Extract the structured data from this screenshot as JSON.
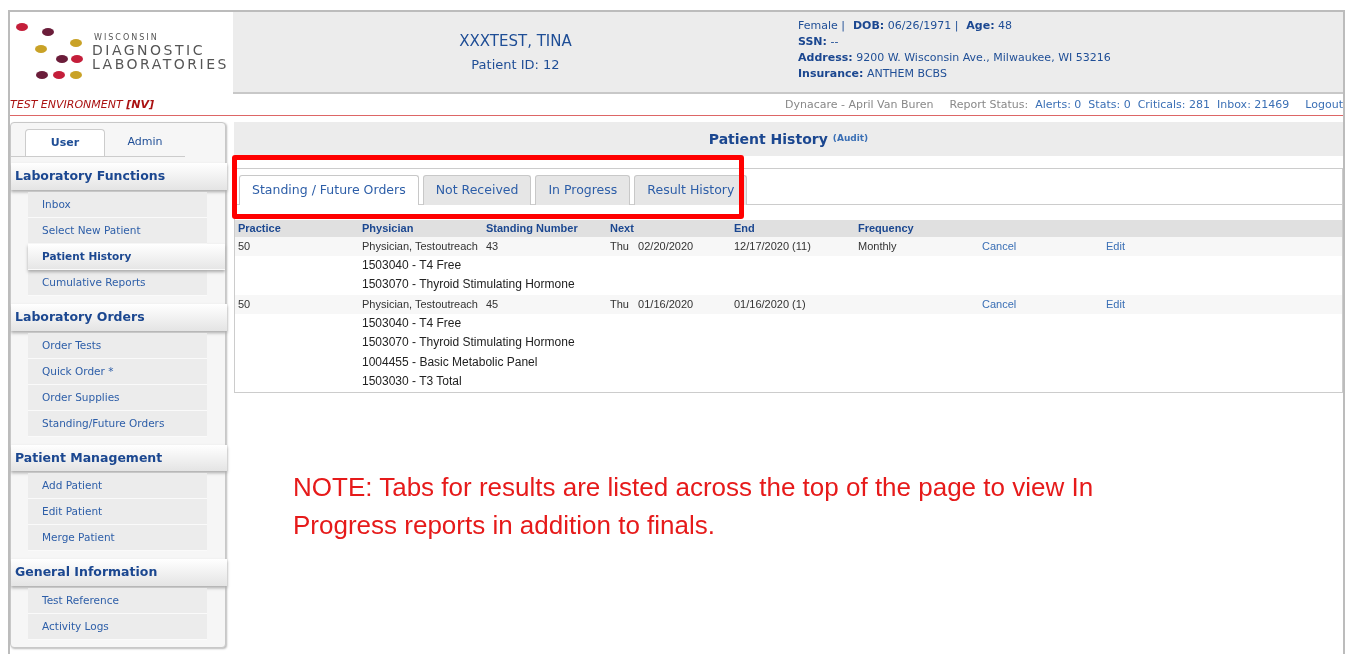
{
  "logo": {
    "lines": [
      "WISCONSIN",
      "DIAGNOSTIC",
      "LABORATORIES"
    ]
  },
  "environment": {
    "label": "TEST ENVIRONMENT",
    "code": "[NV]"
  },
  "patient": {
    "name": "XXXTEST,  TINA",
    "id_label": "Patient ID:",
    "id": "12"
  },
  "demographics": [
    [
      {
        "value": "Female",
        "separator": "|"
      },
      {
        "label": "DOB:",
        "value": "06/26/1971",
        "separator": "|"
      },
      {
        "label": "Age:",
        "value": "48"
      }
    ],
    [
      {
        "label": "SSN:",
        "value": "--"
      }
    ],
    [
      {
        "label": "Address:",
        "value": "9200 W. Wisconsin Ave., Milwaukee, WI 53216"
      }
    ],
    [
      {
        "label": "Insurance:",
        "value": "ANTHEM BCBS"
      }
    ]
  ],
  "status_bar": {
    "user": "Dynacare - April Van Buren",
    "report_label": "Report Status:",
    "links": [
      "Alerts: 0",
      "Stats: 0",
      "Criticals: 281",
      "Inbox: 21469",
      "Logout"
    ]
  },
  "sidebar": {
    "tabs": [
      {
        "label": "User",
        "selected": true
      },
      {
        "label": "Admin",
        "selected": false
      }
    ],
    "sections": [
      {
        "title": "Laboratory Functions",
        "items": [
          {
            "label": "Inbox",
            "selected": false
          },
          {
            "label": "Select New Patient",
            "selected": false
          },
          {
            "label": "Patient History",
            "selected": true
          },
          {
            "label": "Cumulative Reports",
            "selected": false
          }
        ]
      },
      {
        "title": "Laboratory Orders",
        "items": [
          {
            "label": "Order Tests",
            "selected": false
          },
          {
            "label": "Quick Order *",
            "selected": false
          },
          {
            "label": "Order Supplies",
            "selected": false
          },
          {
            "label": "Standing/Future Orders",
            "selected": false
          }
        ]
      },
      {
        "title": "Patient Management",
        "items": [
          {
            "label": "Add Patient",
            "selected": false
          },
          {
            "label": "Edit Patient",
            "selected": false
          },
          {
            "label": "Merge Patient",
            "selected": false
          }
        ]
      },
      {
        "title": "General Information",
        "items": [
          {
            "label": "Test Reference",
            "selected": false
          },
          {
            "label": "Activity Logs",
            "selected": false
          }
        ]
      }
    ]
  },
  "page": {
    "title": "Patient History",
    "subtitle": "(Audit)"
  },
  "tabs": [
    {
      "label": "Standing / Future Orders",
      "selected": true
    },
    {
      "label": "Not Received",
      "selected": false
    },
    {
      "label": "In Progress",
      "selected": false
    },
    {
      "label": "Result History",
      "selected": false
    }
  ],
  "table": {
    "columns": [
      "Practice",
      "Physician",
      "Standing Number",
      "Next",
      "End",
      "Frequency"
    ],
    "rows": [
      {
        "practice": "50",
        "physician": "Physician, Testoutreach",
        "standing_number": "43",
        "next_day": "Thu",
        "next_date": "02/20/2020",
        "end": "12/17/2020 (11)",
        "frequency": "Monthly",
        "cancel": "Cancel",
        "edit": "Edit",
        "tests": [
          "1503040 - T4 Free",
          "1503070 - Thyroid Stimulating Hormone"
        ]
      },
      {
        "practice": "50",
        "physician": "Physician, Testoutreach",
        "standing_number": "45",
        "next_day": "Thu",
        "next_date": "01/16/2020",
        "end": "01/16/2020 (1)",
        "cancel": "Cancel",
        "edit": "Edit",
        "tests": [
          "1503040 - T4 Free",
          "1503070 - Thyroid Stimulating Hormone",
          "1004455 - Basic Metabolic Panel",
          "1503030 - T3 Total"
        ]
      }
    ]
  },
  "note": "NOTE: Tabs for results are listed across the top of the page to view In Progress reports in addition to finals."
}
